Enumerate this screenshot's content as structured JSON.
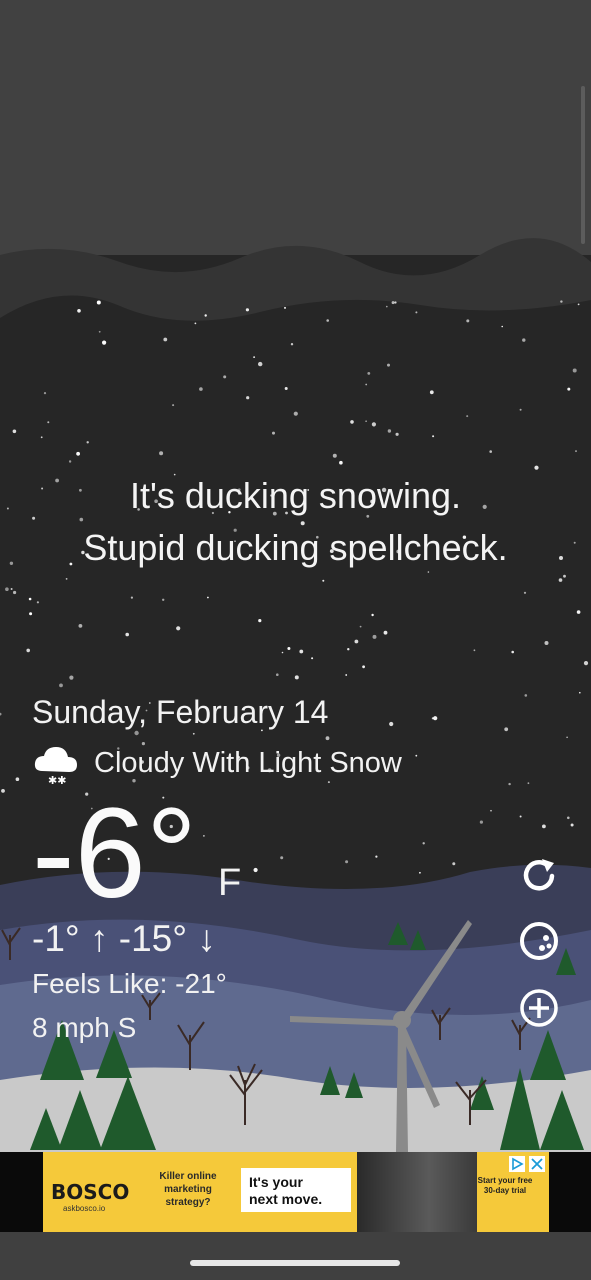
{
  "quote": {
    "line1": "It's ducking snowing.",
    "line2": "Stupid ducking spellcheck."
  },
  "weather": {
    "date": "Sunday, February 14",
    "condition_icon": "cloud-snow-icon",
    "condition": "Cloudy With Light Snow",
    "temperature": "-6°",
    "unit": "F",
    "high": "-1°",
    "low": "-15°",
    "feels_like": "Feels Like: -21°",
    "wind": "8 mph S"
  },
  "actions": {
    "refresh_icon": "refresh-icon",
    "theme_icon": "palette-icon",
    "add_icon": "add-location-icon"
  },
  "ad": {
    "brand": "BOSCO",
    "site": "askbosco.io",
    "copy": "Killer online marketing strategy?",
    "cta_line1": "It's your",
    "cta_line2": "next move.",
    "trial": "Start your free 30-day trial",
    "colors": {
      "background": "#f5c93a"
    }
  },
  "colors": {
    "sky": "#262626",
    "snow_ground": "#c9c9c9",
    "field": "#5f6a8f",
    "tree": "#1f5a2c"
  }
}
